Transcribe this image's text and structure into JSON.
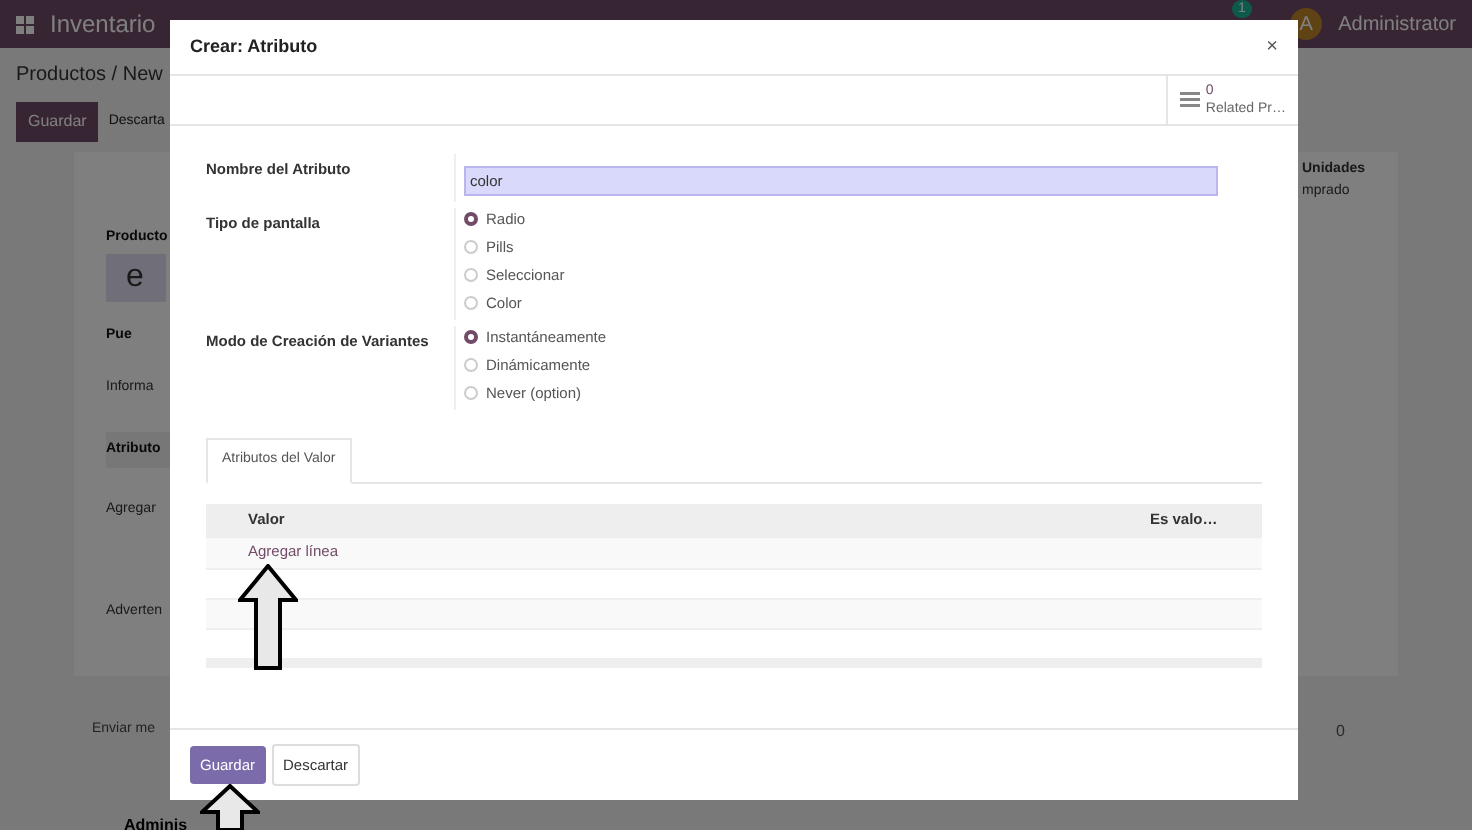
{
  "app": {
    "title": "Inventario",
    "notification_count": "1",
    "user_initial": "A",
    "user_name": "Administrator"
  },
  "background": {
    "breadcrumb": "Productos / New",
    "save": "Guardar",
    "discard": "Descarta",
    "product_label": "Producto",
    "product_name": "e",
    "checkbox_label": "Pue",
    "tab": "Informa",
    "column": "Atributo",
    "add": "Agregar",
    "warning": "Adverten",
    "units": "Unidades",
    "units_sub": "mprado",
    "send": "Enviar me",
    "followers": "0",
    "author": "Adminis"
  },
  "dialog": {
    "title": "Crear: Atributo",
    "close": "×",
    "stat": {
      "count": "0",
      "label": "Related Pr…"
    },
    "fields": [
      {
        "kind": "text",
        "label": "Nombre del Atributo",
        "value": "color"
      },
      {
        "kind": "radio",
        "label": "Tipo de pantalla",
        "options": [
          {
            "label": "Radio",
            "selected": true
          },
          {
            "label": "Pills",
            "selected": false
          },
          {
            "label": "Seleccionar",
            "selected": false
          },
          {
            "label": "Color",
            "selected": false
          }
        ]
      },
      {
        "kind": "radio",
        "label": "Modo de Creación de Variantes",
        "options": [
          {
            "label": "Instantáneamente",
            "selected": true
          },
          {
            "label": "Dinámicamente",
            "selected": false
          },
          {
            "label": "Never (option)",
            "selected": false
          }
        ]
      }
    ],
    "tabs": [
      {
        "label": "Atributos del Valor",
        "selected": true
      }
    ],
    "table": {
      "columns": [
        "Valor",
        "Es valo…"
      ],
      "add_line": "Agregar línea"
    },
    "buttons": [
      {
        "label": "Guardar",
        "kind": "primary"
      },
      {
        "label": "Descartar",
        "kind": "secondary"
      }
    ]
  }
}
